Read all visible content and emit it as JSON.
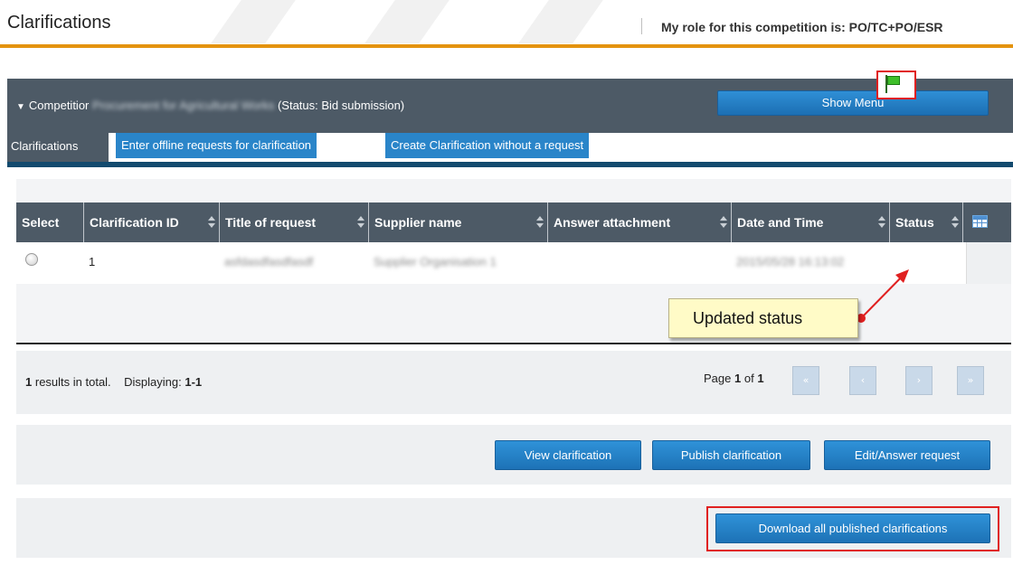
{
  "page": {
    "title": "Clarifications",
    "role_text": "My role for this competition is: PO/TC+PO/ESR"
  },
  "competition_bar": {
    "prefix": "Competitior",
    "blurred_name": "Procurement for Agricultural Works",
    "status": "(Status: Bid submission)",
    "show_menu_label": "Show Menu"
  },
  "tabs": [
    {
      "label": "Clarifications",
      "active": true
    },
    {
      "label": "Enter offline requests for clarification",
      "active": false
    },
    {
      "label": "Create Clarification without a request",
      "active": false
    }
  ],
  "table": {
    "columns": [
      "Select",
      "Clarification ID",
      "Title of request",
      "Supplier name",
      "Answer attachment",
      "Date and Time",
      "Status"
    ],
    "rows": [
      {
        "clarification_id": "1",
        "title": "asfdasdfasdfasdf",
        "supplier": "Supplier Organisation 1",
        "answer_attachment": "",
        "date_time": "2015/05/28 16:13:02",
        "status_icon": "green-flag-icon"
      }
    ]
  },
  "callout": {
    "text": "Updated status"
  },
  "pager": {
    "count": "1",
    "results_suffix": "results in total.",
    "displaying_label": "Displaying:",
    "displaying_range": "1-1",
    "page_label": "Page",
    "page_current": "1",
    "page_of": "of",
    "page_total": "1",
    "first": "«",
    "prev": "‹",
    "next": "›",
    "last": "»"
  },
  "actions": {
    "view": "View clarification",
    "publish": "Publish clarification",
    "edit_answer": "Edit/Answer request",
    "download_all": "Download all published clarifications"
  },
  "colors": {
    "accent_orange": "#e4930e",
    "bar_gray": "#4d5a66",
    "button_blue": "#2a85c9",
    "highlight_red": "#e02020"
  }
}
